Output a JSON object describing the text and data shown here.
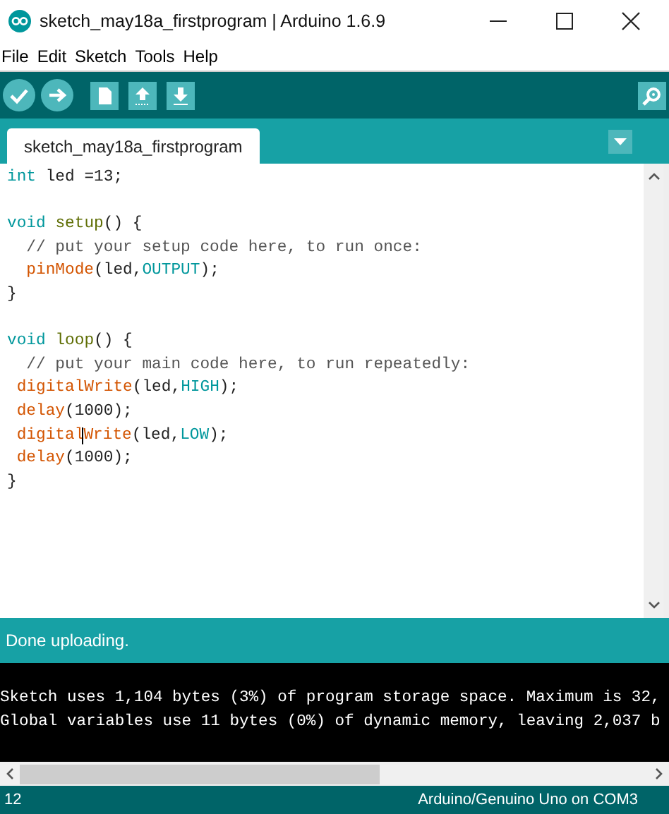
{
  "window": {
    "title": "sketch_may18a_firstprogram | Arduino 1.6.9"
  },
  "menu": [
    "File",
    "Edit",
    "Sketch",
    "Tools",
    "Help"
  ],
  "tabs": [
    {
      "label": "sketch_may18a_firstprogram",
      "selected": true
    }
  ],
  "code_lines": [
    {
      "tokens": [
        {
          "kind": "type",
          "text": "int"
        },
        {
          "kind": "plain",
          "text": " led =13;"
        }
      ]
    },
    {
      "blank": true
    },
    {
      "tokens": [
        {
          "kind": "type",
          "text": "void "
        },
        {
          "kind": "name",
          "text": "setup"
        },
        {
          "kind": "plain",
          "text": "() {"
        }
      ]
    },
    {
      "tokens": [
        {
          "kind": "comment",
          "text": "  // put your setup code here, to run once:"
        }
      ]
    },
    {
      "tokens": [
        {
          "kind": "func",
          "text": "  pinMode"
        },
        {
          "kind": "plain",
          "text": "(led,"
        },
        {
          "kind": "const",
          "text": "OUTPUT"
        },
        {
          "kind": "plain",
          "text": ");"
        }
      ]
    },
    {
      "tokens": [
        {
          "kind": "plain",
          "text": "}"
        }
      ]
    },
    {
      "blank": true
    },
    {
      "tokens": [
        {
          "kind": "type",
          "text": "void "
        },
        {
          "kind": "name",
          "text": "loop"
        },
        {
          "kind": "plain",
          "text": "() {"
        }
      ]
    },
    {
      "tokens": [
        {
          "kind": "comment",
          "text": "  // put your main code here, to run repeatedly:"
        }
      ]
    },
    {
      "tokens": [
        {
          "kind": "func",
          "text": " digitalWrite"
        },
        {
          "kind": "plain",
          "text": "(led,"
        },
        {
          "kind": "const",
          "text": "HIGH"
        },
        {
          "kind": "plain",
          "text": ");"
        }
      ]
    },
    {
      "tokens": [
        {
          "kind": "func",
          "text": " delay"
        },
        {
          "kind": "plain",
          "text": "(1000);"
        }
      ]
    },
    {
      "tokens": [
        {
          "kind": "func",
          "text": " digital"
        },
        {
          "kind": "func",
          "text": "Write",
          "caret": true
        },
        {
          "kind": "plain",
          "text": "(led,"
        },
        {
          "kind": "const",
          "text": "LOW"
        },
        {
          "kind": "plain",
          "text": ");"
        }
      ]
    },
    {
      "tokens": [
        {
          "kind": "func",
          "text": " delay"
        },
        {
          "kind": "plain",
          "text": "(1000);"
        }
      ]
    },
    {
      "tokens": [
        {
          "kind": "plain",
          "text": "}"
        }
      ]
    }
  ],
  "status_message": "Done uploading.",
  "console_lines": [
    "Sketch uses 1,104 bytes (3%) of program storage space. Maximum is 32,",
    "Global variables use 11 bytes (0%) of dynamic memory, leaving 2,037 b"
  ],
  "status_bar": {
    "line": "12",
    "board": "Arduino/Genuino Uno on COM3"
  }
}
